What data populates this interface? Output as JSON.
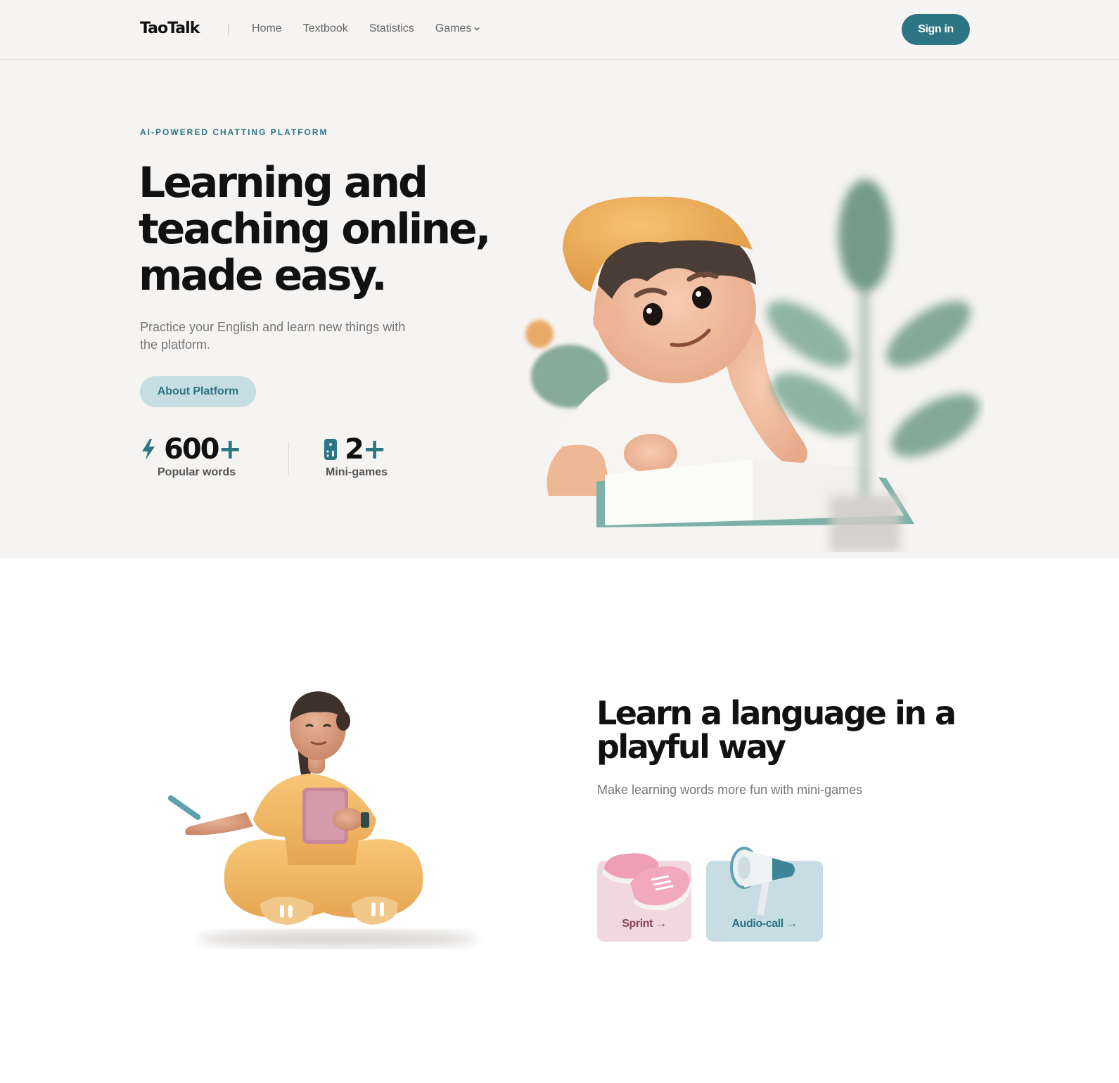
{
  "header": {
    "logo": "TaoTalk",
    "nav": [
      {
        "label": "Home"
      },
      {
        "label": "Textbook"
      },
      {
        "label": "Statistics"
      },
      {
        "label": "Games"
      }
    ],
    "signin_label": "Sign in"
  },
  "hero": {
    "eyebrow": "AI-POWERED CHATTING PLATFORM",
    "title": "Learning and teaching online, made easy.",
    "subtitle": "Practice your English and learn new things with the platform.",
    "cta_label": "About Platform",
    "stats": [
      {
        "icon": "lightning-icon",
        "value": "600",
        "suffix": "+",
        "label": "Popular words"
      },
      {
        "icon": "game-controller-icon",
        "value": "2",
        "suffix": "+",
        "label": "Mini-games"
      }
    ]
  },
  "section2": {
    "title": "Learn a language in a playful way",
    "subtitle": "Make learning words more fun with mini-games",
    "games": [
      {
        "label": "Sprint →",
        "icon": "sneakers-icon"
      },
      {
        "label": "Audio-call →",
        "icon": "megaphone-icon"
      }
    ]
  },
  "colors": {
    "accent": "#2c7584",
    "hero_bg": "#f6f4f2",
    "sprint_card": "#f1d7df",
    "audio_card": "#c7dde3",
    "about_button": "#c5dde3"
  }
}
